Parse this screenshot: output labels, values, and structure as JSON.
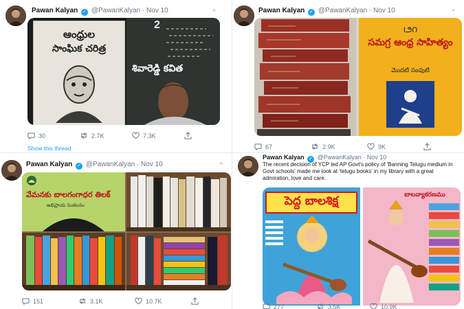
{
  "tweets": [
    {
      "author": "Pawan Kalyan",
      "handle": "@PawanKalyan",
      "date": "Nov 10",
      "separator": "·",
      "replies": "30",
      "retweets": "2.7K",
      "likes": "7.3K",
      "show_thread": "Show this thread",
      "books": {
        "left_title_1": "ఆంధ్రుల",
        "left_title_2": "సాంఘిక చరిత్ర",
        "right_title": "శివారెడ్డి కవిత",
        "right_number": "2"
      }
    },
    {
      "author": "Pawan Kalyan",
      "handle": "@PawanKalyan",
      "date": "Nov 10",
      "separator": "·",
      "replies": "67",
      "retweets": "2.9K",
      "likes": "9K",
      "books": {
        "right_top": "౹౨౧",
        "right_title": "సమగ్ర ఆంధ్ర సాహిత్యం",
        "right_subtitle": "మొదటి సంపుటి"
      }
    },
    {
      "author": "Pawan Kalyan",
      "handle": "@PawanKalyan",
      "date": "Nov 10",
      "separator": "·",
      "replies": "151",
      "retweets": "3.1K",
      "likes": "10.7K",
      "books": {
        "left_title": "వేమనకు బాలగంగాధర తిలక్",
        "left_subtitle": "అభిప్రాయ సంకలనం"
      }
    },
    {
      "author": "Pawan Kalyan",
      "handle": "@PawanKalyan",
      "date": "Nov 10",
      "separator": "·",
      "text": "The recent decision of YCP led AP Govt's policy of 'Banning Telugu medium in Govt schools' made me look at 'telugu books' in my library with a great admiration, love and care.",
      "replies": "277",
      "retweets": "3.5K",
      "likes": "10.9K",
      "books": {
        "left_title": "పెద్ద బాలశిక్ష",
        "right_title": "బాలవ్యాకరణము"
      }
    }
  ],
  "colors": {
    "accent": "#1da1f2",
    "muted": "#657786",
    "text": "#14171a"
  },
  "icons": [
    "reply-icon",
    "retweet-icon",
    "like-icon",
    "share-icon",
    "verified-icon",
    "caret-icon"
  ]
}
